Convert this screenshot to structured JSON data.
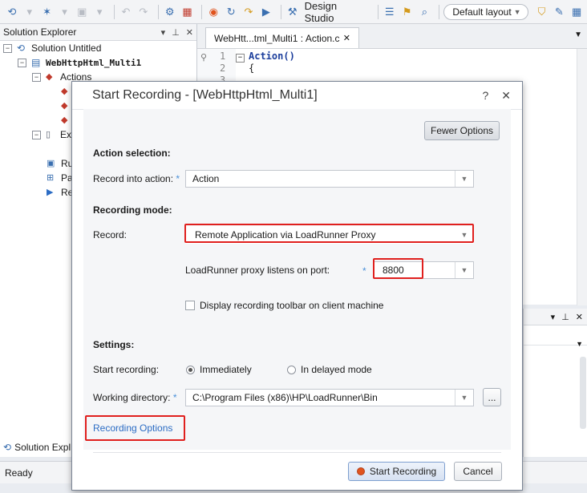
{
  "toolbar": {
    "design_studio_label": "Design Studio",
    "layout_value": "Default layout"
  },
  "solution_explorer": {
    "title": "Solution Explorer",
    "solution_name": "Solution Untitled",
    "script_name": "WebHttpHtml_Multi1",
    "actions_label": "Actions",
    "partial_items": [
      "Ex",
      "Ru",
      "Pa",
      "Re"
    ],
    "bottom_tab": "Solution Expl"
  },
  "editor": {
    "tab_label": "WebHtt...tml_Multi1 : Action.c",
    "lines": [
      {
        "num": "1",
        "text": "Action()"
      },
      {
        "num": "2",
        "text": "{"
      },
      {
        "num": "3",
        "text": ""
      }
    ]
  },
  "status": {
    "text": "Ready"
  },
  "dialog": {
    "title": "Start Recording - [WebHttpHtml_Multi1]",
    "fewer_options_label": "Fewer Options",
    "action_selection_heading": "Action selection:",
    "record_into_label": "Record into action:",
    "record_into_value": "Action",
    "recording_mode_heading": "Recording mode:",
    "record_label": "Record:",
    "record_value": "Remote Application via LoadRunner Proxy",
    "proxy_port_label": "LoadRunner proxy listens on port:",
    "proxy_port_value": "8800",
    "display_toolbar_label": "Display recording toolbar on client machine",
    "settings_heading": "Settings:",
    "start_recording_label": "Start recording:",
    "immediately_label": "Immediately",
    "delayed_label": "In delayed mode",
    "working_dir_label": "Working directory:",
    "working_dir_value": "C:\\Program Files (x86)\\HP\\LoadRunner\\Bin",
    "browse_label": "...",
    "recording_options_link": "Recording Options",
    "start_button": "Start Recording",
    "cancel_button": "Cancel",
    "help_label": "?",
    "close_label": "✕"
  },
  "colors": {
    "highlight_red": "#e0201e",
    "link_blue": "#2b6cc4",
    "required_star": "#4a90d9",
    "record_dot": "#e0531d"
  }
}
